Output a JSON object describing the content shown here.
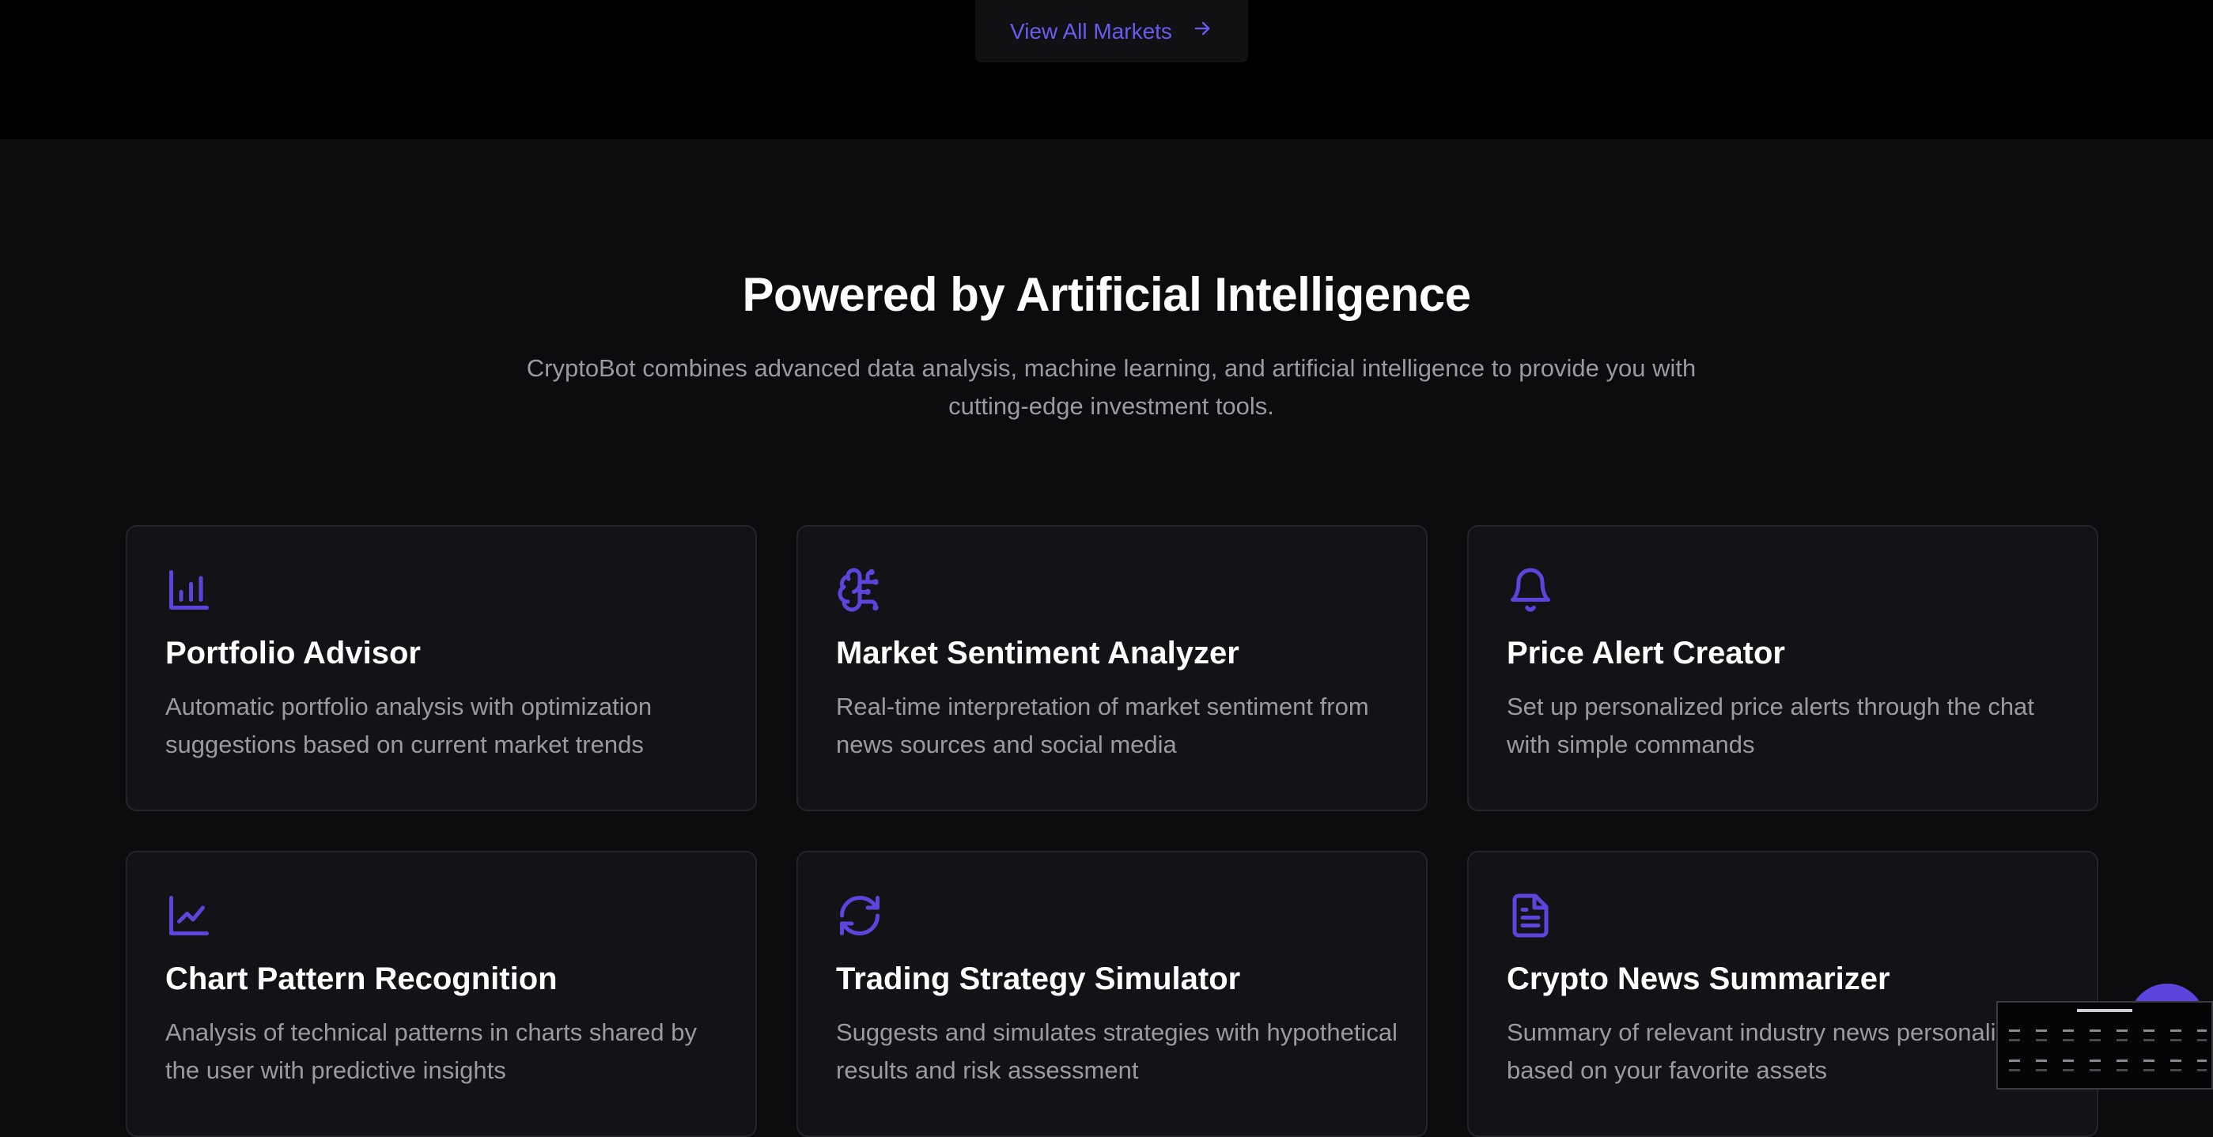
{
  "header": {
    "view_all_label": "View All Markets",
    "view_all_icon": "arrow-right-icon"
  },
  "section": {
    "title": "Powered by Artificial Intelligence",
    "subtitle": "CryptoBot combines advanced data analysis, machine learning, and artificial intelligence to provide you with cutting-edge investment tools."
  },
  "features": [
    {
      "icon": "bar-chart-icon",
      "title": "Portfolio Advisor",
      "description": "Automatic portfolio analysis with optimization suggestions based on current market trends"
    },
    {
      "icon": "brain-circuit-icon",
      "title": "Market Sentiment Analyzer",
      "description": "Real-time interpretation of market sentiment from news sources and social media"
    },
    {
      "icon": "bell-icon",
      "title": "Price Alert Creator",
      "description": "Set up personalized price alerts through the chat with simple commands"
    },
    {
      "icon": "line-chart-icon",
      "title": "Chart Pattern Recognition",
      "description": "Analysis of technical patterns in charts shared by the user with predictive insights"
    },
    {
      "icon": "refresh-icon",
      "title": "Trading Strategy Simulator",
      "description": "Suggests and simulates strategies with hypothetical results and risk assessment"
    },
    {
      "icon": "file-text-icon",
      "title": "Crypto News Summarizer",
      "description": "Summary of relevant industry news personalized based on your favorite assets"
    }
  ],
  "colors": {
    "accent": "#5b45dd",
    "link": "#6a5bf0",
    "background": "#0c0c0f",
    "card_background": "#131317",
    "card_border": "#24242a",
    "muted_text": "#9a9aa3"
  }
}
